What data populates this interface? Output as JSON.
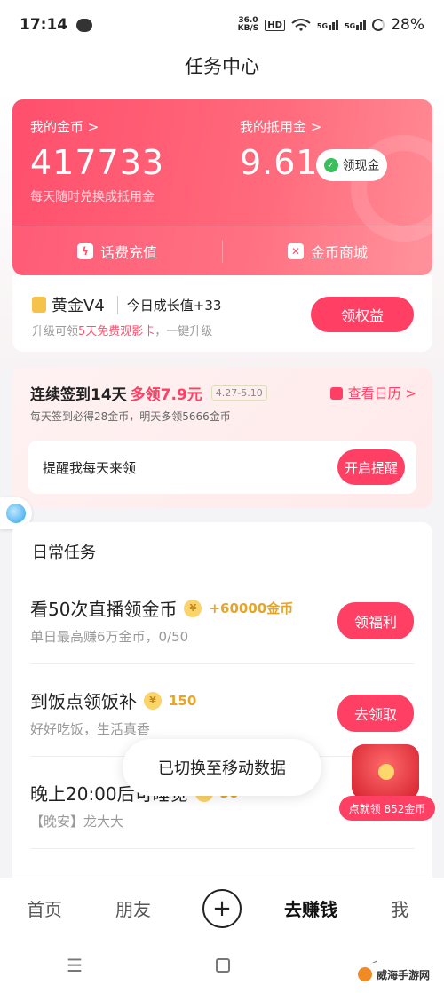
{
  "status": {
    "time": "17:14",
    "net_speed": "36.0\nKB/S",
    "hd": "HD",
    "sig1": "5G",
    "sig2": "5G",
    "battery": "28%"
  },
  "header": {
    "title": "任务中心"
  },
  "coins": {
    "my_coins_label": "我的金币 >",
    "my_coins_value": "417733",
    "coins_sub": "每天随时兑换成抵用金",
    "voucher_label": "我的抵用金 >",
    "voucher_value": "9.61",
    "cash_button": "领现金",
    "recharge_label": "话费充值",
    "mall_label": "金币商城"
  },
  "vip": {
    "level": "黄金V4",
    "growth": "今日成长值+33",
    "desc_pre": "升级可领",
    "desc_highlight": "5天免费观影卡",
    "desc_post": "，一键升级",
    "button": "领权益"
  },
  "signin": {
    "title_pre": "连续签到14天",
    "title_highlight": "多领7.9元",
    "date_range": "4.27-5.10",
    "calendar_link": "查看日历 >",
    "sub": "每天签到必得28金币，明天多领5666金币",
    "remind_text": "提醒我每天来领",
    "remind_button": "开启提醒"
  },
  "daily": {
    "header": "日常任务",
    "tasks": [
      {
        "name": "看50次直播领金币",
        "reward": "+60000金币",
        "desc": "单日最高赚6万金币，0/50",
        "button": "领福利"
      },
      {
        "name": "到饭点领饭补",
        "reward": "150",
        "desc": "好好吃饭，生活真香",
        "button": "去领取"
      },
      {
        "name": "晚上20:00后可睡觉",
        "reward": "30",
        "desc": "【晚安】龙大大",
        "button": ""
      }
    ]
  },
  "toast": {
    "text": "已切换至移动数据"
  },
  "gift": {
    "label": "点就领 852金币"
  },
  "tabbar": {
    "home": "首页",
    "friends": "朋友",
    "plus": "+",
    "earn": "去赚钱",
    "me": "我"
  },
  "navbar": {
    "menu": "☰",
    "back": "◁"
  },
  "watermark": {
    "text": "威海手游网"
  }
}
